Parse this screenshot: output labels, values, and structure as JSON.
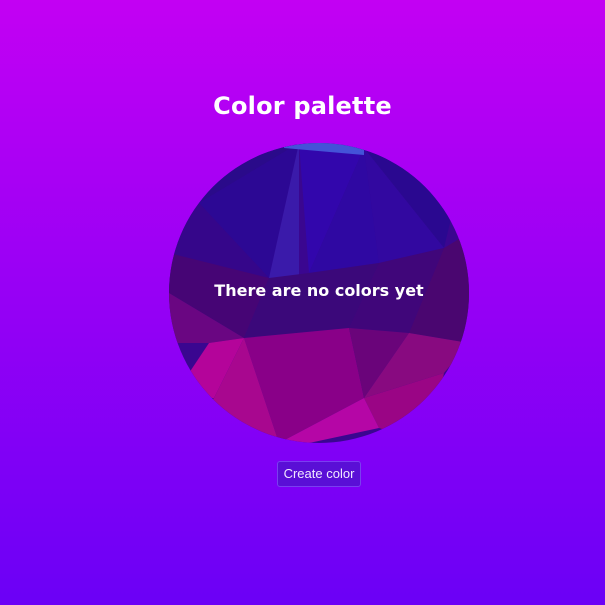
{
  "page": {
    "title": "Color palette",
    "empty_message": "There are no colors yet"
  },
  "actions": {
    "create_label": "Create color"
  },
  "colors": {
    "background_top": "#c300f3",
    "background_bottom": "#6b00f6",
    "button_fill": "#5a0fd6"
  }
}
